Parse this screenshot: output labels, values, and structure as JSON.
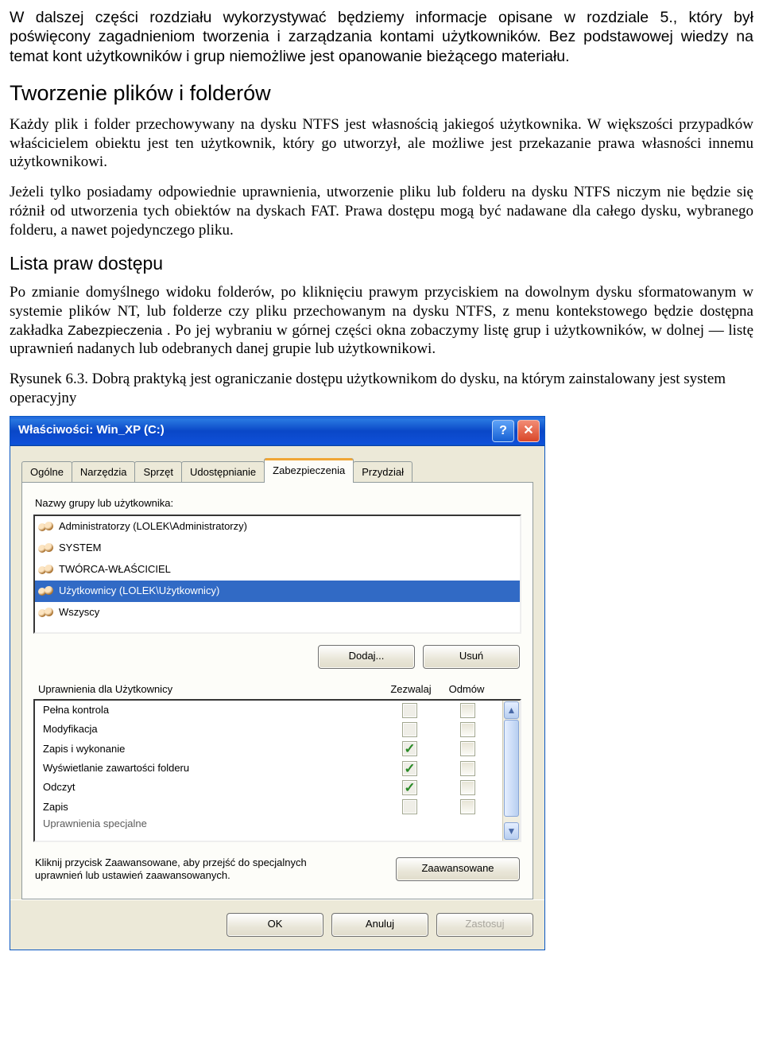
{
  "para1": "W dalszej części rozdziału wykorzystywać będziemy informacje opisane w rozdziale 5., który był poświęcony zagadnieniom tworzenia i zarządzania kontami użytkowników. Bez podstawowej wiedzy na temat kont użytkowników i grup niemożliwe jest opanowanie bieżącego materiału.",
  "heading1": "Tworzenie plików i folderów",
  "para2": "Każdy plik i folder przechowywany na dysku NTFS jest własnością jakiegoś użytkownika. W większości przypadków właścicielem obiektu jest ten użytkownik, który go utworzył, ale możliwe jest przekazanie prawa własności innemu użytkownikowi.",
  "para3": "Jeżeli tylko posiadamy odpowiednie uprawnienia, utworzenie pliku lub folderu na dysku NTFS niczym nie będzie się różnił od utworzenia tych obiektów na dyskach FAT. Prawa dostępu mogą być nadawane dla całego dysku, wybranego folderu, a nawet pojedynczego pliku.",
  "heading2": "Lista praw dostępu",
  "para4_a": "Po zmianie domyślnego widoku folderów, po kliknięciu prawym przyciskiem na dowolnym dysku sformatowanym w systemie plików NT, lub folderze czy pliku przechowanym na dysku NTFS, z menu kontekstowego będzie dostępna zakładka ",
  "para4_tab": "Zabezpieczenia",
  "para4_b": ". Po jej wybraniu w górnej części okna zobaczymy listę grup i użytkowników, w dolnej — listę uprawnień nadanych lub odebranych danej grupie lub użytkownikowi.",
  "figcap": "Rysunek 6.3. Dobrą praktyką jest ograniczanie dostępu użytkownikom do dysku, na którym zainstalowany jest system operacyjny",
  "dialog": {
    "title": "Właściwości: Win_XP (C:)",
    "help_char": "?",
    "close_char": "✕",
    "tabs": [
      "Ogólne",
      "Narzędzia",
      "Sprzęt",
      "Udostępnianie",
      "Zabezpieczenia",
      "Przydział"
    ],
    "active_tab_index": 4,
    "group_label": "Nazwy grupy lub użytkownika:",
    "groups": [
      {
        "text": "Administratorzy (LOLEK\\Administratorzy)",
        "selected": false
      },
      {
        "text": "SYSTEM",
        "selected": false
      },
      {
        "text": "TWÓRCA-WŁAŚCICIEL",
        "selected": false
      },
      {
        "text": "Użytkownicy (LOLEK\\Użytkownicy)",
        "selected": true
      },
      {
        "text": "Wszyscy",
        "selected": false
      }
    ],
    "btn_add": "Dodaj...",
    "btn_remove": "Usuń",
    "perm_heading": "Uprawnienia dla Użytkownicy",
    "col_allow": "Zezwalaj",
    "col_deny": "Odmów",
    "permissions": [
      {
        "name": "Pełna kontrola",
        "allow": false,
        "deny": false,
        "disabled": true
      },
      {
        "name": "Modyfikacja",
        "allow": false,
        "deny": false,
        "disabled": true
      },
      {
        "name": "Zapis i wykonanie",
        "allow": true,
        "deny": false,
        "disabled": true
      },
      {
        "name": "Wyświetlanie zawartości folderu",
        "allow": true,
        "deny": false,
        "disabled": true
      },
      {
        "name": "Odczyt",
        "allow": true,
        "deny": false,
        "disabled": true
      },
      {
        "name": "Zapis",
        "allow": false,
        "deny": false,
        "disabled": true
      }
    ],
    "perm_cut": "Uprawnienia specjalne",
    "advanced_hint": "Kliknij przycisk Zaawansowane, aby przejść do specjalnych uprawnień lub ustawień zaawansowanych.",
    "btn_advanced": "Zaawansowane",
    "btn_ok": "OK",
    "btn_cancel": "Anuluj",
    "btn_apply": "Zastosuj"
  }
}
